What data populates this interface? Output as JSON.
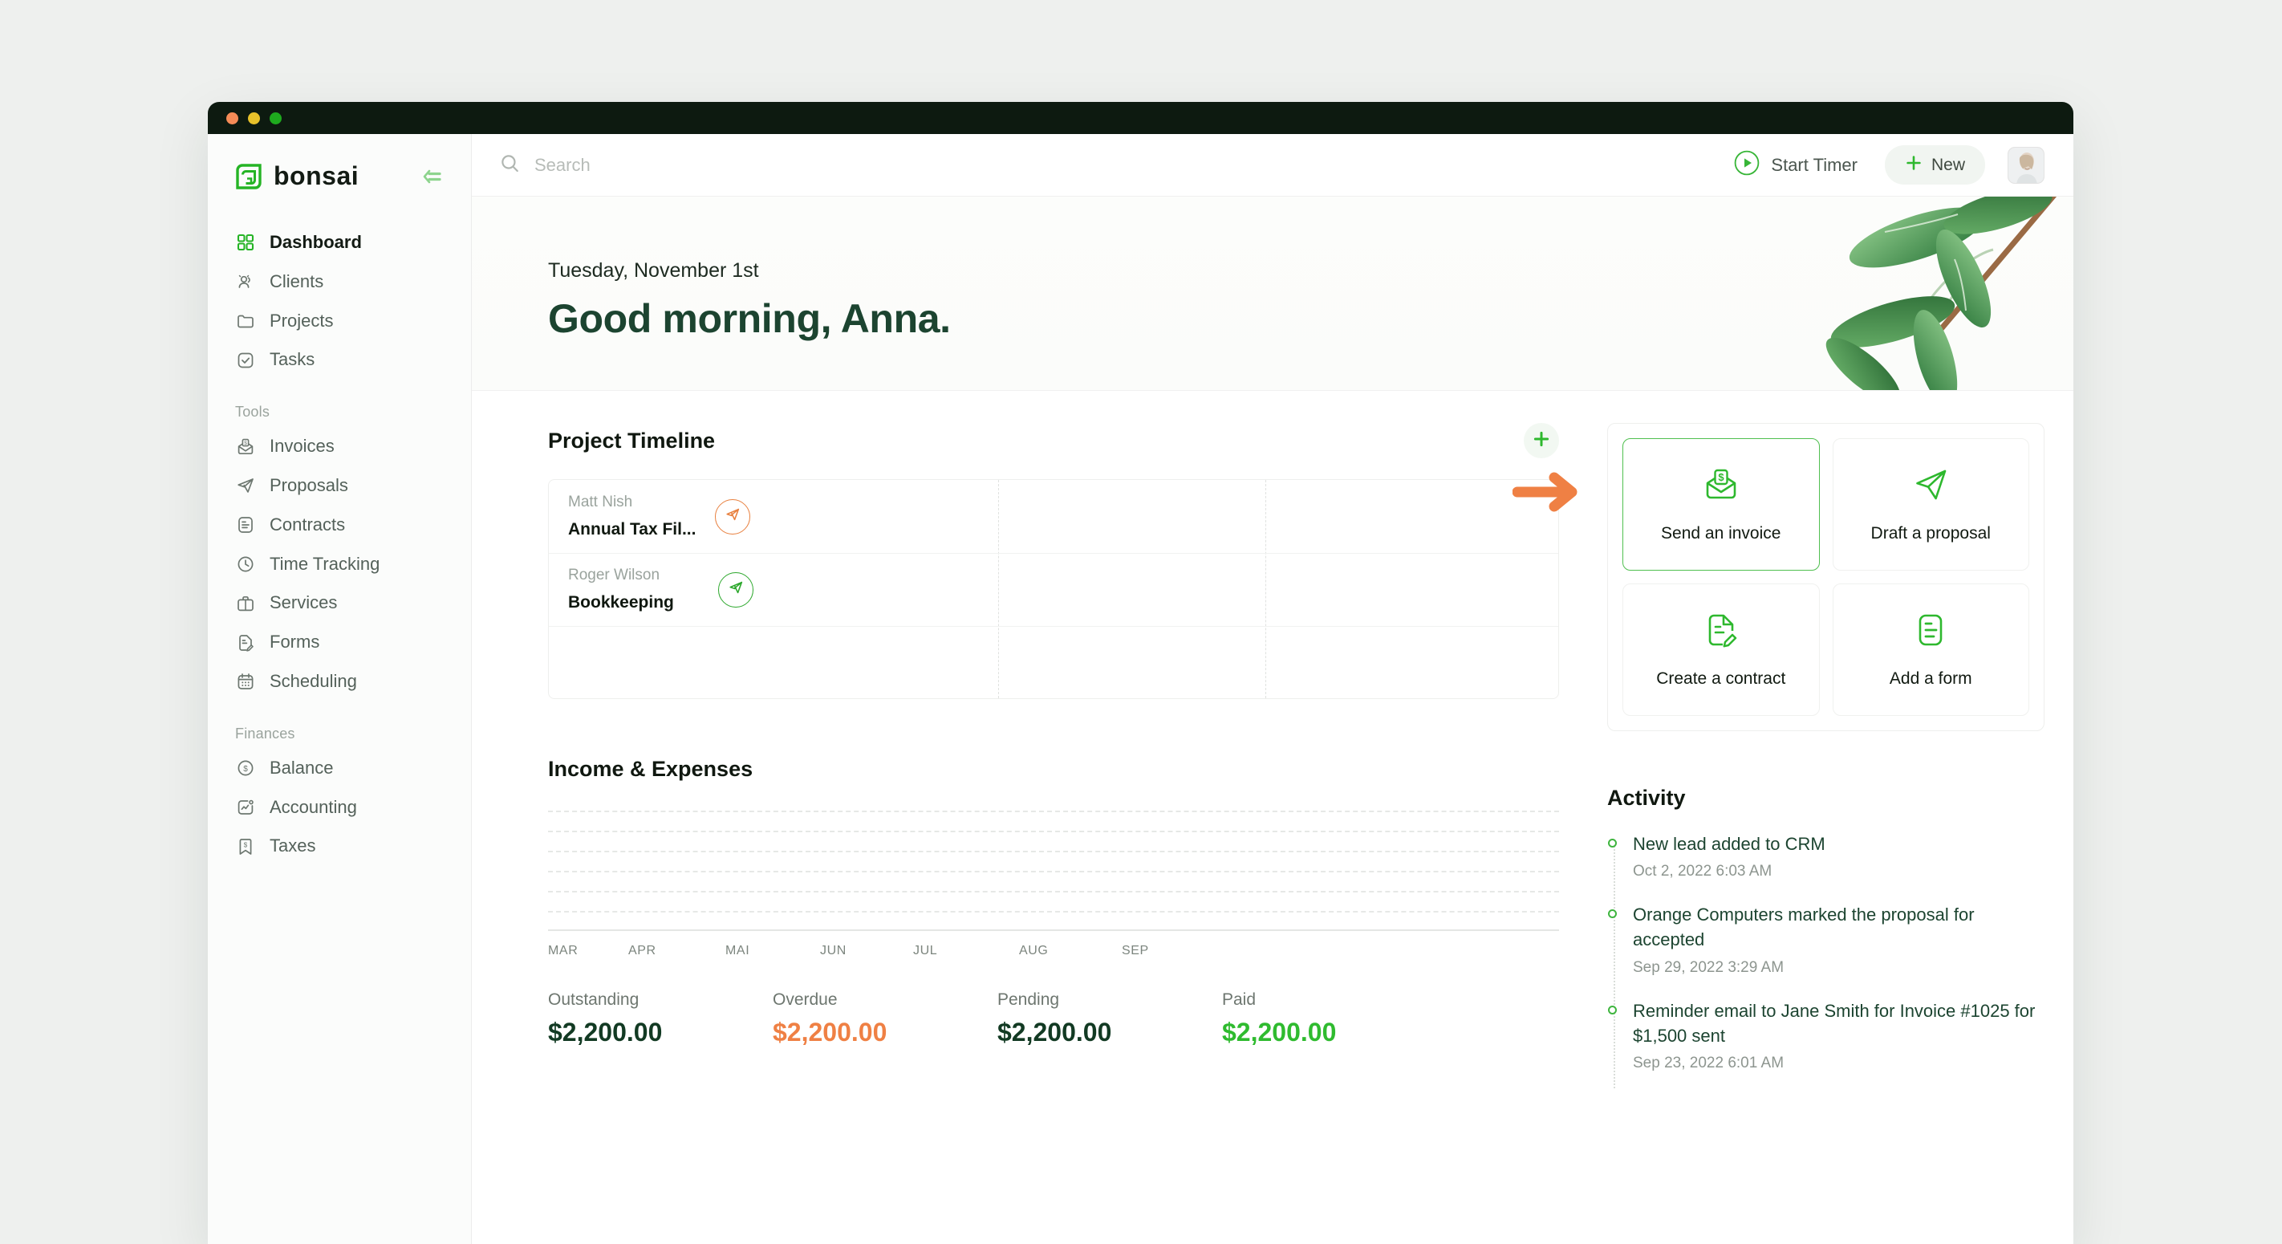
{
  "brand": {
    "name": "bonsai",
    "logo_icon": "bonsai-logo-icon"
  },
  "window_controls": {
    "close": "close",
    "minimize": "minimize",
    "maximize": "maximize"
  },
  "sidebar": {
    "collapse_icon": "collapse-sidebar-icon",
    "primary": [
      {
        "label": "Dashboard",
        "icon": "grid-icon",
        "active": true
      },
      {
        "label": "Clients",
        "icon": "users-icon",
        "active": false
      },
      {
        "label": "Projects",
        "icon": "folder-icon",
        "active": false
      },
      {
        "label": "Tasks",
        "icon": "check-square-icon",
        "active": false
      }
    ],
    "sections": [
      {
        "title": "Tools",
        "items": [
          {
            "label": "Invoices",
            "icon": "invoice-envelope-icon"
          },
          {
            "label": "Proposals",
            "icon": "paper-plane-icon"
          },
          {
            "label": "Contracts",
            "icon": "document-lines-icon"
          },
          {
            "label": "Time Tracking",
            "icon": "clock-icon"
          },
          {
            "label": "Services",
            "icon": "briefcase-icon"
          },
          {
            "label": "Forms",
            "icon": "document-edit-icon"
          },
          {
            "label": "Scheduling",
            "icon": "calendar-icon"
          }
        ]
      },
      {
        "title": "Finances",
        "items": [
          {
            "label": "Balance",
            "icon": "dollar-circle-icon"
          },
          {
            "label": "Accounting",
            "icon": "chart-bubble-icon"
          },
          {
            "label": "Taxes",
            "icon": "tax-tag-icon"
          }
        ]
      }
    ]
  },
  "topbar": {
    "search_placeholder": "Search",
    "search_value": "",
    "search_icon": "search-icon",
    "timer_label": "Start Timer",
    "timer_icon": "play-circle-icon",
    "new_label": "New",
    "new_icon": "plus-icon",
    "avatar_icon": "user-avatar"
  },
  "hero": {
    "date": "Tuesday, November 1st",
    "greeting": "Good morning, Anna.",
    "decoration_icon": "bonsai-branch-illustration"
  },
  "timeline": {
    "title": "Project Timeline",
    "add_icon": "plus-icon",
    "rows": [
      {
        "client": "Matt Nish",
        "project": "Annual Tax Fil...",
        "badge_icon": "paper-plane-icon",
        "badge_color": "#e8803f"
      },
      {
        "client": "Roger Wilson",
        "project": "Bookkeeping",
        "badge_icon": "paper-plane-icon",
        "badge_color": "#2ba72b"
      }
    ]
  },
  "chart_data": {
    "type": "line",
    "title": "Income & Expenses",
    "categories": [
      "MAR",
      "APR",
      "MAI",
      "JUN",
      "JUL",
      "AUG",
      "SEP"
    ],
    "series": [
      {
        "name": "Income",
        "values": [
          0,
          0,
          0,
          0,
          0,
          0,
          0
        ]
      },
      {
        "name": "Expenses",
        "values": [
          0,
          0,
          0,
          0,
          0,
          0,
          0
        ]
      }
    ],
    "xlabel": "",
    "ylabel": "",
    "ylim": [
      0,
      6
    ],
    "grid": true,
    "gridlines": 6,
    "legend": "none",
    "note": "No data series plotted; only dashed horizontal gridlines and month tick labels are visible."
  },
  "stats": [
    {
      "label": "Outstanding",
      "value": "$2,200.00",
      "color": "#123a23"
    },
    {
      "label": "Overdue",
      "value": "$2,200.00",
      "color": "#ef8044"
    },
    {
      "label": "Pending",
      "value": "$2,200.00",
      "color": "#123a23"
    },
    {
      "label": "Paid",
      "value": "$2,200.00",
      "color": "#2fbb2f"
    }
  ],
  "quick_actions": {
    "annotation_icon": "orange-right-arrow",
    "cards": [
      {
        "label": "Send an invoice",
        "icon": "invoice-envelope-icon",
        "selected": true
      },
      {
        "label": "Draft a proposal",
        "icon": "paper-plane-icon",
        "selected": false
      },
      {
        "label": "Create a contract",
        "icon": "document-edit-icon",
        "selected": false
      },
      {
        "label": "Add a form",
        "icon": "document-lines-icon",
        "selected": false
      }
    ]
  },
  "activity": {
    "title": "Activity",
    "items": [
      {
        "text": "New lead added to CRM",
        "time": "Oct 2, 2022  6:03 AM"
      },
      {
        "text": "Orange Computers marked the proposal for accepted",
        "time": "Sep 29, 2022  3:29 AM"
      },
      {
        "text": "Reminder email to Jane Smith for Invoice #1025 for $1,500 sent",
        "time": "Sep 23, 2022  6:01 AM"
      }
    ]
  },
  "colors": {
    "brand_green": "#25b425",
    "dark_green": "#1c4430",
    "orange_accent": "#ef8044",
    "paid_green": "#2fbb2f"
  }
}
